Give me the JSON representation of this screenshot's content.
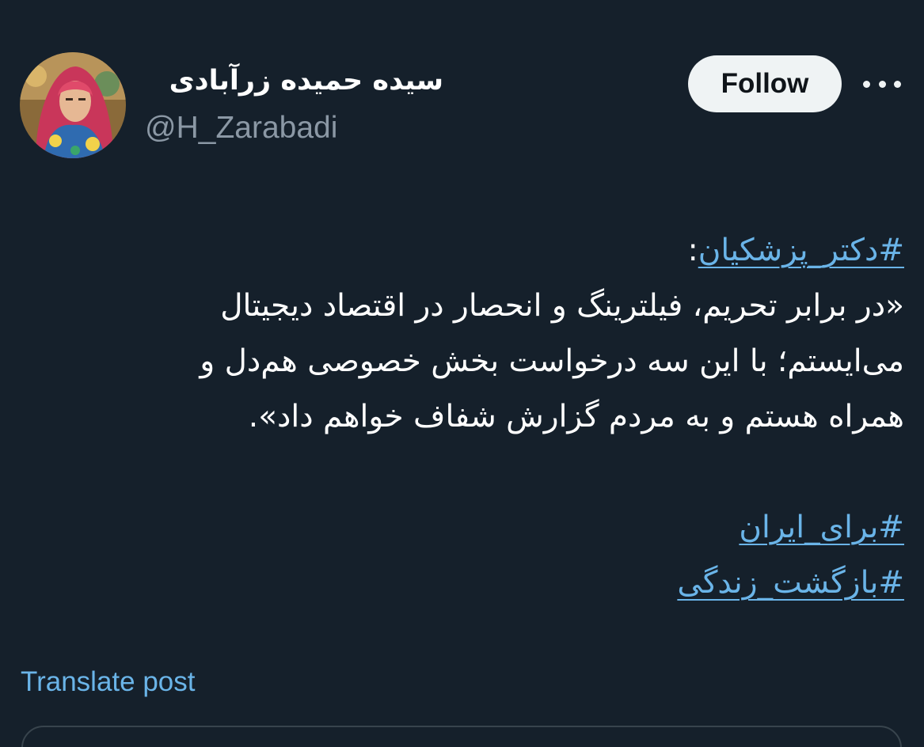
{
  "author": {
    "display_name": "سیده حمیده زرآبادی",
    "handle": "@H_Zarabadi",
    "avatar_icon": "profile-photo-icon"
  },
  "actions": {
    "follow_label": "Follow",
    "more_icon": "more-horizontal-icon"
  },
  "tweet": {
    "hashtag_1": "#دکتر_پزشکیان",
    "hashtag_1_suffix": ":",
    "lines": [
      "«در برابر تحریم، فیلترینگ و انحصار در اقتصاد دیجیتال",
      "می‌ایستم؛ با این سه درخواست بخش خصوصی هم‌دل و",
      "همراه هستم و به مردم گزارش شفاف خواهم داد»."
    ],
    "hashtags": [
      "#برای_ایران",
      "#بازگشت_زندگی"
    ]
  },
  "footer": {
    "translate_label": "Translate post"
  },
  "colors": {
    "background": "#15202b",
    "text": "#ffffff",
    "secondary_text": "#8b98a5",
    "link": "#6ab4e8",
    "button_bg": "#eff3f4"
  }
}
